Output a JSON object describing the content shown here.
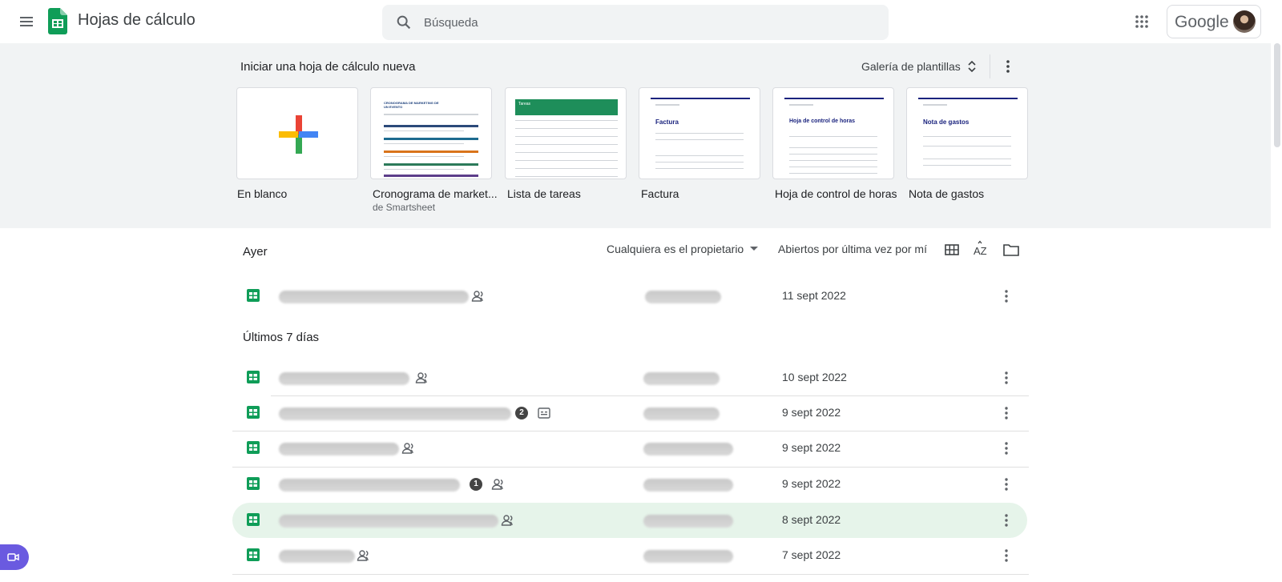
{
  "header": {
    "app_title": "Hojas de cálculo",
    "search_placeholder": "Búsqueda",
    "account_brand": "Google"
  },
  "gallery": {
    "title": "Iniciar una hoja de cálculo nueva",
    "gallery_button": "Galería de plantillas",
    "templates": [
      {
        "label": "En blanco",
        "sub": ""
      },
      {
        "label": "Cronograma de market...",
        "sub": "de Smartsheet"
      },
      {
        "label": "Lista de tareas",
        "sub": ""
      },
      {
        "label": "Factura",
        "sub": ""
      },
      {
        "label": "Hoja de control de horas",
        "sub": ""
      },
      {
        "label": "Nota de gastos",
        "sub": ""
      }
    ],
    "thumb_text": {
      "factura_title": "Factura",
      "horas_title": "Hoja de control de horas",
      "gastos_title": "Nota de gastos",
      "tareas_title": "Tareas",
      "crono_title": "CRONOGRAMA DE MARKETING DE UN EVENTO"
    }
  },
  "list": {
    "owner_filter": "Cualquiera es el propietario",
    "sort_label": "Abiertos por última vez por mí",
    "sections": [
      {
        "label": "Ayer"
      },
      {
        "label": "Últimos 7 días"
      }
    ],
    "rows": [
      {
        "date": "11 sept 2022",
        "shared": true,
        "selected": false
      },
      {
        "date": "10 sept 2022",
        "shared": true,
        "selected": false
      },
      {
        "date": "9 sept 2022",
        "shared": false,
        "badge": "2",
        "form": true,
        "selected": false
      },
      {
        "date": "9 sept 2022",
        "shared": true,
        "selected": false
      },
      {
        "date": "9 sept 2022",
        "shared": true,
        "badge": "1",
        "selected": false
      },
      {
        "date": "8 sept 2022",
        "shared": true,
        "selected": true
      },
      {
        "date": "7 sept 2022",
        "shared": true,
        "selected": false
      }
    ]
  },
  "colors": {
    "sheets_green": "#0f9d58",
    "selected_row": "#e6f4ea",
    "meet_purple": "#6a5ae0"
  },
  "icons": [
    "menu-icon",
    "sheets-logo-icon",
    "search-icon",
    "apps-grid-icon",
    "unfold-icon",
    "more-vert-icon",
    "grid-view-icon",
    "sort-az-icon",
    "folder-icon",
    "shared-people-icon",
    "form-icon",
    "video-camera-icon"
  ]
}
